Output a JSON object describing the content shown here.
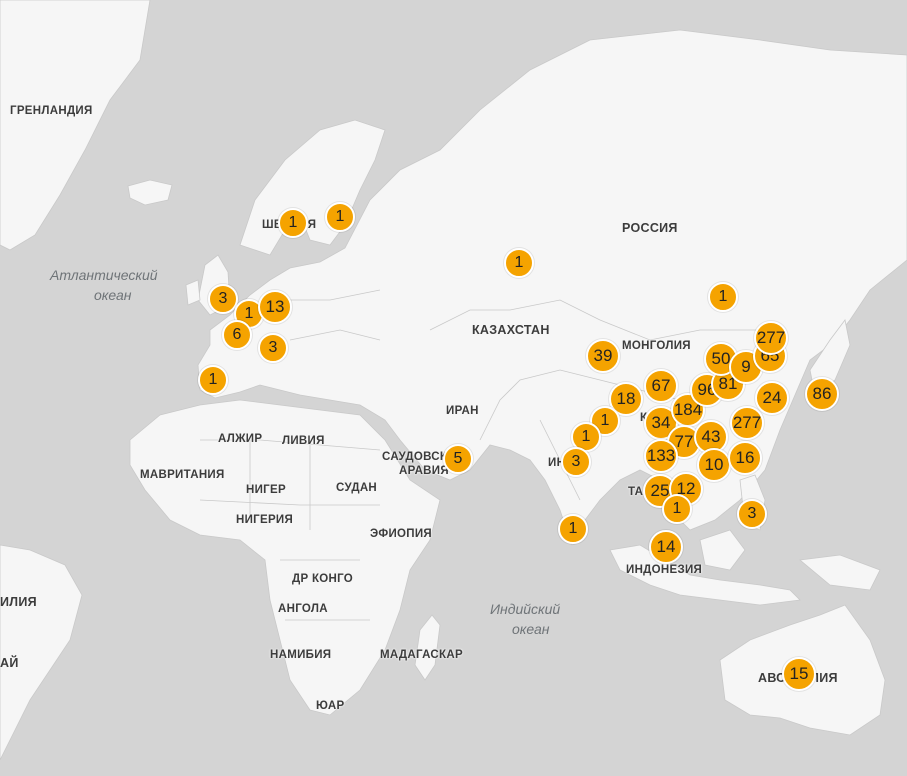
{
  "map": {
    "colors": {
      "water": "#d4d4d4",
      "land": "#f6f6f6",
      "border": "#c9c9c9",
      "cluster_fill": "#f5a300",
      "cluster_stroke": "#ffffff"
    },
    "country_labels": {
      "greenland": "ГРЕНЛАНДИЯ",
      "sweden": "ШВЕЦИЯ",
      "russia": "РОССИЯ",
      "kazakhstan": "КАЗАХСТАН",
      "mongolia": "МОНГОЛИЯ",
      "iran": "ИРАН",
      "algeria": "АЛЖИР",
      "libya": "ЛИВИЯ",
      "mauritania": "МАВРИТАНИЯ",
      "niger": "НИГЕР",
      "sudan": "СУДАН",
      "saudi_1": "САУДОВСКАЯ",
      "saudi_2": "АРАВИЯ",
      "nigeria": "НИГЕРИЯ",
      "ethiopia": "ЭФИОПИЯ",
      "drc": "ДР КОНГО",
      "angola": "АНГОЛА",
      "namibia": "НАМИБИЯ",
      "madagascar": "МАДАГАСКАР",
      "sa": "ЮАР",
      "india": "ИНДИЯ",
      "thailand": "ТАИ",
      "indonesia": "ИНДОНЕЗИЯ",
      "australia": "АВСТРАЛИЯ",
      "chile": "ИЛИЯ",
      "uruguay": "АЙ",
      "china_partial": "К"
    },
    "ocean_labels": {
      "atlantic_1": "Атлантический",
      "atlantic_2": "океан",
      "indian_1": "Индийский",
      "indian_2": "океан"
    },
    "clusters": [
      {
        "id": "sweden-1",
        "count": "1"
      },
      {
        "id": "finland-1",
        "count": "1"
      },
      {
        "id": "uk-3",
        "count": "3"
      },
      {
        "id": "nl-1",
        "count": "1"
      },
      {
        "id": "de-13",
        "count": "13"
      },
      {
        "id": "fr-6",
        "count": "6"
      },
      {
        "id": "ch-3",
        "count": "3"
      },
      {
        "id": "es-1",
        "count": "1"
      },
      {
        "id": "ru-west-1",
        "count": "1"
      },
      {
        "id": "ru-east-1",
        "count": "1"
      },
      {
        "id": "xinjiang-39",
        "count": "39"
      },
      {
        "id": "tibet-18",
        "count": "18"
      },
      {
        "id": "nepal-1",
        "count": "1"
      },
      {
        "id": "india-1",
        "count": "1"
      },
      {
        "id": "bangladesh-3",
        "count": "3"
      },
      {
        "id": "uae-5",
        "count": "5"
      },
      {
        "id": "srilanka-1",
        "count": "1"
      },
      {
        "id": "gansu-67",
        "count": "67"
      },
      {
        "id": "cn-34",
        "count": "34"
      },
      {
        "id": "cn-184",
        "count": "184"
      },
      {
        "id": "cn-96",
        "count": "96"
      },
      {
        "id": "cn-81",
        "count": "81"
      },
      {
        "id": "cn-50",
        "count": "50"
      },
      {
        "id": "cn-9",
        "count": "9"
      },
      {
        "id": "cn-65",
        "count": "65"
      },
      {
        "id": "cn-277a",
        "count": "277"
      },
      {
        "id": "cn-277b",
        "count": "277"
      },
      {
        "id": "cn-24",
        "count": "24"
      },
      {
        "id": "jp-86",
        "count": "86"
      },
      {
        "id": "cn-77",
        "count": "77"
      },
      {
        "id": "cn-43",
        "count": "43"
      },
      {
        "id": "cn-133",
        "count": "133"
      },
      {
        "id": "cn-10",
        "count": "10"
      },
      {
        "id": "cn-16",
        "count": "16"
      },
      {
        "id": "cn-25",
        "count": "25"
      },
      {
        "id": "cn-12",
        "count": "12"
      },
      {
        "id": "vn-1",
        "count": "1"
      },
      {
        "id": "ph-3",
        "count": "3"
      },
      {
        "id": "my-14",
        "count": "14"
      },
      {
        "id": "au-15",
        "count": "15"
      }
    ]
  }
}
